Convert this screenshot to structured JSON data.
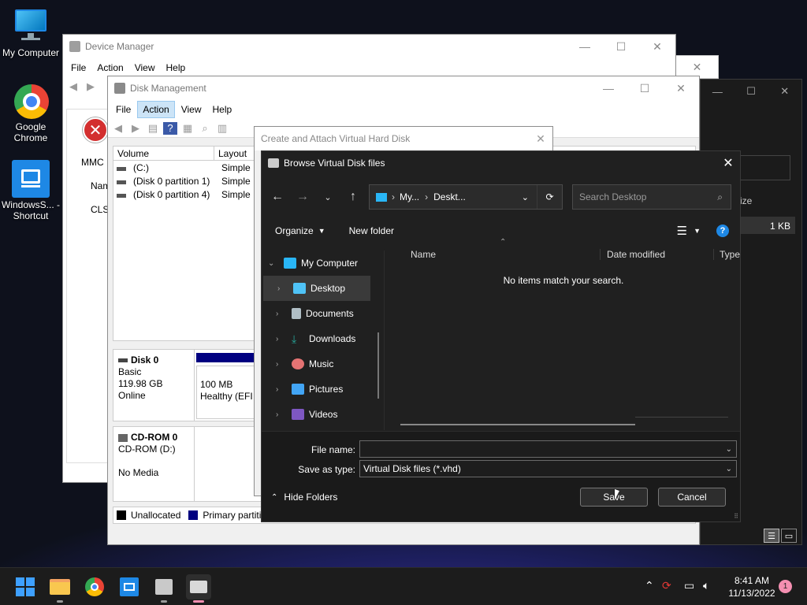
{
  "desktop": {
    "icons": [
      {
        "label": "My Computer"
      },
      {
        "label": "Google Chrome"
      },
      {
        "label": "WindowsS... - Shortcut"
      }
    ]
  },
  "device_manager": {
    "title": "Device Manager",
    "menu": [
      "File",
      "Action",
      "View",
      "Help"
    ],
    "left_labels": [
      "MMC",
      "Nam",
      "CLSI"
    ]
  },
  "disk_management": {
    "title": "Disk Management",
    "menu": [
      "File",
      "Action",
      "View",
      "Help"
    ],
    "active_menu": "Action",
    "columns": [
      "Volume",
      "Layout"
    ],
    "volumes": [
      {
        "name": "(C:)",
        "layout": "Simple"
      },
      {
        "name": "(Disk 0 partition 1)",
        "layout": "Simple"
      },
      {
        "name": "(Disk 0 partition 4)",
        "layout": "Simple"
      }
    ],
    "disk0": {
      "name": "Disk 0",
      "type": "Basic",
      "size": "119.98 GB",
      "status": "Online",
      "partition_size": "100 MB",
      "partition_status": "Healthy (EFI S"
    },
    "cdrom": {
      "name": "CD-ROM 0",
      "drive": "CD-ROM (D:)",
      "status": "No Media"
    },
    "legend": [
      "Unallocated",
      "Primary partitio"
    ]
  },
  "create_vhd": {
    "title": "Create and Attach Virtual Hard Disk"
  },
  "right_window": {
    "partial_header": "ize",
    "partial_size": "1 KB"
  },
  "browse_dialog": {
    "title": "Browse Virtual Disk files",
    "breadcrumb": [
      "My...",
      "Deskt..."
    ],
    "search_placeholder": "Search Desktop",
    "organize": "Organize",
    "new_folder": "New folder",
    "tree": [
      {
        "label": "My Computer",
        "expanded": true
      },
      {
        "label": "Desktop",
        "selected": true
      },
      {
        "label": "Documents"
      },
      {
        "label": "Downloads"
      },
      {
        "label": "Music"
      },
      {
        "label": "Pictures"
      },
      {
        "label": "Videos"
      }
    ],
    "columns": [
      "Name",
      "Date modified",
      "Type"
    ],
    "empty_message": "No items match your search.",
    "file_name_label": "File name:",
    "file_name_value": "",
    "save_type_label": "Save as type:",
    "save_type_value": "Virtual Disk files (*.vhd)",
    "hide_folders": "Hide Folders",
    "save_button": "Save",
    "cancel_button": "Cancel"
  },
  "taskbar": {
    "time": "8:41 AM",
    "date": "11/13/2022",
    "notification_count": "1"
  },
  "colors": {
    "accent": "#0a84ff",
    "partition_bar": "#000080"
  }
}
